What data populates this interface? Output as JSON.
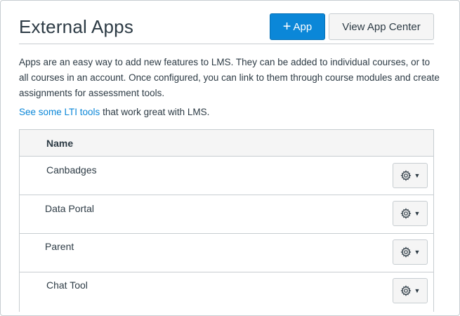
{
  "header": {
    "title": "External Apps",
    "add_button_label": "App",
    "view_button_label": "View App Center"
  },
  "description": "Apps are an easy way to add new features to LMS. They can be added to individual courses, or to all courses in an account. Once configured, you can link to them through course modules and create assignments for assessment tools.",
  "tools_line": {
    "link_text": "See some LTI tools",
    "suffix": " that work great with LMS."
  },
  "table": {
    "column_header": "Name",
    "rows": [
      {
        "name": "Canbadges"
      },
      {
        "name": "Data Portal"
      },
      {
        "name": "Parent"
      },
      {
        "name": "Chat Tool"
      }
    ]
  },
  "icons": {
    "plus": "plus-icon",
    "gear": "gear-icon",
    "caret": "caret-down-icon"
  },
  "colors": {
    "accent": "#0b87d8",
    "text": "#2d3b45",
    "border": "#c7cdd1"
  }
}
